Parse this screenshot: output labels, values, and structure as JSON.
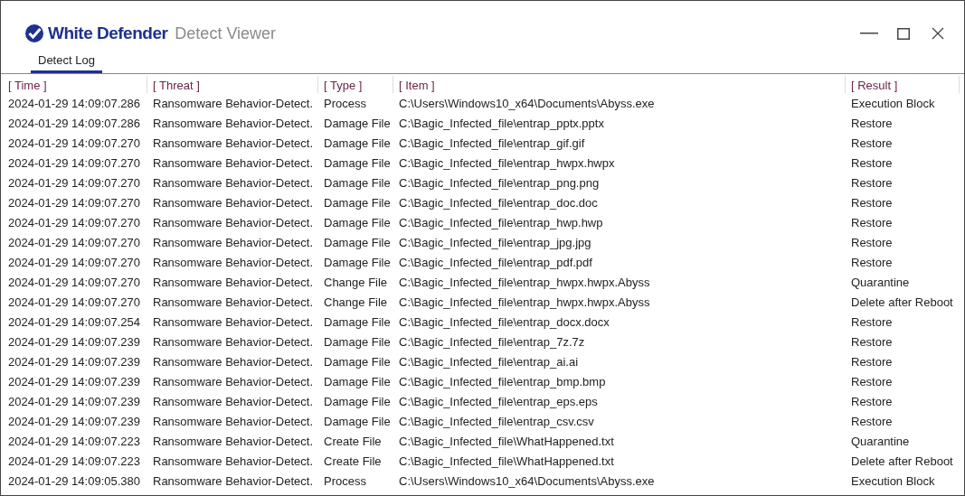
{
  "window": {
    "brand": "White Defender",
    "title": "Detect Viewer"
  },
  "tabs": [
    {
      "label": "Detect Log",
      "selected": true
    }
  ],
  "table": {
    "columns": [
      "[ Time ]",
      "[ Threat ]",
      "[ Type ]",
      "[ Item ]",
      "[ Result ]"
    ],
    "rows": [
      [
        "2024-01-29 14:09:07.286",
        "Ransomware Behavior-Detect.",
        "Process",
        "C:\\Users\\Windows10_x64\\Documents\\Abyss.exe",
        "Execution Block"
      ],
      [
        "2024-01-29 14:09:07.286",
        "Ransomware Behavior-Detect.",
        "Damage File",
        "C:\\Bagic_Infected_file\\entrap_pptx.pptx",
        "Restore"
      ],
      [
        "2024-01-29 14:09:07.270",
        "Ransomware Behavior-Detect.",
        "Damage File",
        "C:\\Bagic_Infected_file\\entrap_gif.gif",
        "Restore"
      ],
      [
        "2024-01-29 14:09:07.270",
        "Ransomware Behavior-Detect.",
        "Damage File",
        "C:\\Bagic_Infected_file\\entrap_hwpx.hwpx",
        "Restore"
      ],
      [
        "2024-01-29 14:09:07.270",
        "Ransomware Behavior-Detect.",
        "Damage File",
        "C:\\Bagic_Infected_file\\entrap_png.png",
        "Restore"
      ],
      [
        "2024-01-29 14:09:07.270",
        "Ransomware Behavior-Detect.",
        "Damage File",
        "C:\\Bagic_Infected_file\\entrap_doc.doc",
        "Restore"
      ],
      [
        "2024-01-29 14:09:07.270",
        "Ransomware Behavior-Detect.",
        "Damage File",
        "C:\\Bagic_Infected_file\\entrap_hwp.hwp",
        "Restore"
      ],
      [
        "2024-01-29 14:09:07.270",
        "Ransomware Behavior-Detect.",
        "Damage File",
        "C:\\Bagic_Infected_file\\entrap_jpg.jpg",
        "Restore"
      ],
      [
        "2024-01-29 14:09:07.270",
        "Ransomware Behavior-Detect.",
        "Damage File",
        "C:\\Bagic_Infected_file\\entrap_pdf.pdf",
        "Restore"
      ],
      [
        "2024-01-29 14:09:07.270",
        "Ransomware Behavior-Detect.",
        "Change File",
        "C:\\Bagic_Infected_file\\entrap_hwpx.hwpx.Abyss",
        "Quarantine"
      ],
      [
        "2024-01-29 14:09:07.270",
        "Ransomware Behavior-Detect.",
        "Change File",
        "C:\\Bagic_Infected_file\\entrap_hwpx.hwpx.Abyss",
        "Delete after Reboot"
      ],
      [
        "2024-01-29 14:09:07.254",
        "Ransomware Behavior-Detect.",
        "Damage File",
        "C:\\Bagic_Infected_file\\entrap_docx.docx",
        "Restore"
      ],
      [
        "2024-01-29 14:09:07.239",
        "Ransomware Behavior-Detect.",
        "Damage File",
        "C:\\Bagic_Infected_file\\entrap_7z.7z",
        "Restore"
      ],
      [
        "2024-01-29 14:09:07.239",
        "Ransomware Behavior-Detect.",
        "Damage File",
        "C:\\Bagic_Infected_file\\entrap_ai.ai",
        "Restore"
      ],
      [
        "2024-01-29 14:09:07.239",
        "Ransomware Behavior-Detect.",
        "Damage File",
        "C:\\Bagic_Infected_file\\entrap_bmp.bmp",
        "Restore"
      ],
      [
        "2024-01-29 14:09:07.239",
        "Ransomware Behavior-Detect.",
        "Damage File",
        "C:\\Bagic_Infected_file\\entrap_eps.eps",
        "Restore"
      ],
      [
        "2024-01-29 14:09:07.239",
        "Ransomware Behavior-Detect.",
        "Damage File",
        "C:\\Bagic_Infected_file\\entrap_csv.csv",
        "Restore"
      ],
      [
        "2024-01-29 14:09:07.223",
        "Ransomware Behavior-Detect.",
        "Create File",
        "C:\\Bagic_Infected_file\\WhatHappened.txt",
        "Quarantine"
      ],
      [
        "2024-01-29 14:09:07.223",
        "Ransomware Behavior-Detect.",
        "Create File",
        "C:\\Bagic_Infected_file\\WhatHappened.txt",
        "Delete after Reboot"
      ],
      [
        "2024-01-29 14:09:05.380",
        "Ransomware Behavior-Detect.",
        "Process",
        "C:\\Users\\Windows10_x64\\Documents\\Abyss.exe",
        "Execution Block"
      ]
    ]
  }
}
